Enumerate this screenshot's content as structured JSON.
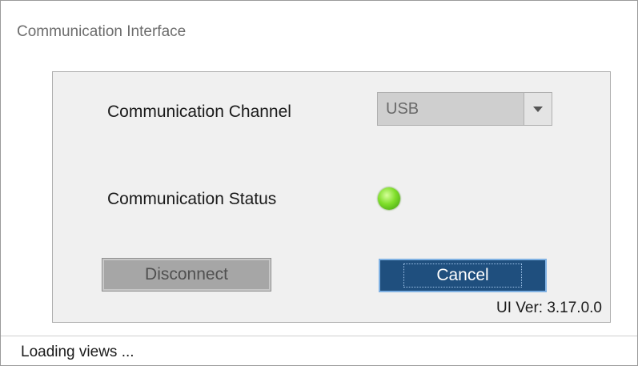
{
  "window": {
    "title": "Communication Interface"
  },
  "form": {
    "channel_label": "Communication Channel",
    "channel_value": "USB",
    "status_label": "Communication Status",
    "status_color": "#7fde2a",
    "disconnect_label": "Disconnect",
    "cancel_label": "Cancel",
    "version_text": "UI Ver: 3.17.0.0"
  },
  "status_bar": {
    "text": "Loading views ..."
  },
  "icons": {
    "dropdown": "chevron-down-icon",
    "status_led": "status-led-icon"
  }
}
